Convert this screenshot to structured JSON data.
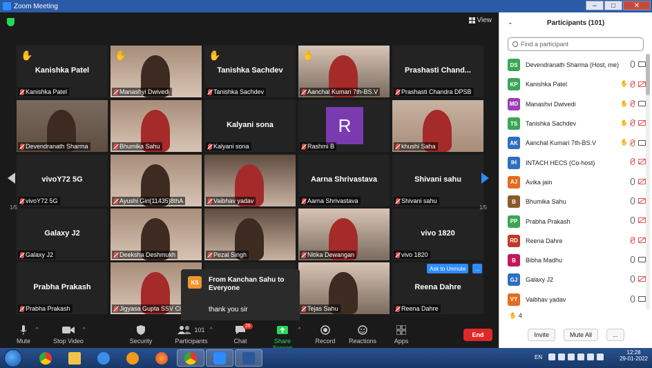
{
  "window": {
    "title": "Zoom Meeting"
  },
  "view_label": "View",
  "tiles": [
    {
      "center": "Kanishka Patel",
      "label": "Kanishka Patel",
      "hand": true,
      "video": false
    },
    {
      "center": "",
      "label": "Manashyi Dwivedi",
      "hand": true,
      "video": true
    },
    {
      "center": "Tanishka Sachdev",
      "label": "Tanishka Sachdev",
      "hand": true,
      "video": false
    },
    {
      "center": "",
      "label": "Aanchal Kumari 7th-BS.V",
      "hand": true,
      "video": true
    },
    {
      "center": "Prashasti  Chand...",
      "label": "Prashasti Chandra DPSB",
      "hand": false,
      "video": false
    },
    {
      "center": "",
      "label": "Devendranath Sharma",
      "hand": false,
      "video": true
    },
    {
      "center": "",
      "label": "Bhumika Sahu",
      "hand": false,
      "video": true
    },
    {
      "center": "Kalyani sona",
      "label": "Kalyani sona",
      "hand": false,
      "video": false
    },
    {
      "center": "",
      "label": "Rashmi B",
      "hand": false,
      "video": false,
      "avatar": "R"
    },
    {
      "center": "",
      "label": "khushi Saha",
      "hand": false,
      "video": true
    },
    {
      "center": "vivoY72 5G",
      "label": "vivoY72 5G",
      "hand": false,
      "video": false
    },
    {
      "center": "",
      "label": "Ayushi Giri(11435)8thA",
      "hand": false,
      "video": true
    },
    {
      "center": "",
      "label": "Vaibhav yadav",
      "hand": false,
      "video": true
    },
    {
      "center": "Aarna Shrivastava",
      "label": "Aarna Shrivastava",
      "hand": false,
      "video": false
    },
    {
      "center": "Shivani sahu",
      "label": "Shivani sahu",
      "hand": false,
      "video": false
    },
    {
      "center": "Galaxy J2",
      "label": "Galaxy J2",
      "hand": false,
      "video": false
    },
    {
      "center": "",
      "label": "Deeksha Deshmukh",
      "hand": false,
      "video": true
    },
    {
      "center": "",
      "label": "Pezal Singh",
      "hand": false,
      "video": true
    },
    {
      "center": "",
      "label": "Nitika Dewangan",
      "hand": false,
      "video": true
    },
    {
      "center": "vivo 1820",
      "label": "vivo 1820",
      "hand": false,
      "video": false
    },
    {
      "center": "Prabha Prakash",
      "label": "Prabha Prakash",
      "hand": false,
      "video": false
    },
    {
      "center": "",
      "label": "Jigyasa Gupta SSV Cl",
      "hand": false,
      "video": true
    },
    {
      "center": "",
      "label": "",
      "hand": false,
      "video": false
    },
    {
      "center": "",
      "label": "Tejas Sahu",
      "hand": false,
      "video": true
    },
    {
      "center": "Reena Dahre",
      "label": "Reena Dahre",
      "hand": false,
      "video": false
    }
  ],
  "pager": {
    "left": "1/5",
    "right": "1/5"
  },
  "toast": {
    "initials": "KS",
    "from": "From Kanchan Sahu to Everyone",
    "message": "thank you sir"
  },
  "ask_unmute": "Ask to Unmute",
  "more": "...",
  "toolbar": {
    "mute": "Mute",
    "video": "Stop Video",
    "security": "Security",
    "participants": "Participants",
    "participant_count": "101",
    "chat": "Chat",
    "chat_badge": "26",
    "share": "Share Screen",
    "record": "Record",
    "reactions": "Reactions",
    "apps": "Apps",
    "end": "End"
  },
  "panel": {
    "title": "Participants (101)",
    "search_placeholder": "Find a participant",
    "participants": [
      {
        "initials": "DS",
        "color": "#3aa655",
        "name": "Devendranath Sharma  (Host, me)",
        "hand": "none",
        "mic": "on",
        "cam": "on"
      },
      {
        "initials": "KP",
        "color": "#3aa655",
        "name": "Kanishka Patel",
        "hand": "raised",
        "mic": "off",
        "cam": "off"
      },
      {
        "initials": "MD",
        "color": "#9b3fb5",
        "name": "Manashvi Dwivedi",
        "hand": "faded",
        "mic": "off",
        "cam": "on"
      },
      {
        "initials": "TS",
        "color": "#3aa655",
        "name": "Tanishka Sachdev",
        "hand": "raised",
        "mic": "off",
        "cam": "off"
      },
      {
        "initials": "AK",
        "color": "#2f6fbf",
        "name": "Aanchal Kumari 7th-BS.V",
        "hand": "raised",
        "mic": "off",
        "cam": "on"
      },
      {
        "initials": "IH",
        "color": "#2f6fbf",
        "name": "INTACH HECS (Co-host)",
        "hand": "none",
        "mic": "off",
        "cam": "off"
      },
      {
        "initials": "AJ",
        "color": "#e56b1f",
        "name": "Avika jain",
        "hand": "none",
        "mic": "on",
        "cam": "off"
      },
      {
        "initials": "B",
        "color": "#8a5a2b",
        "name": "Bhumika Sahu",
        "hand": "none",
        "mic": "on",
        "cam": "off"
      },
      {
        "initials": "PP",
        "color": "#3aa655",
        "name": "Prabha Prakash",
        "hand": "none",
        "mic": "on",
        "cam": "off"
      },
      {
        "initials": "RD",
        "color": "#c0392b",
        "name": "Reena Dahre",
        "hand": "none",
        "mic": "off",
        "cam": "off"
      },
      {
        "initials": "B",
        "color": "#c2185b",
        "name": "Bibha Madhu",
        "hand": "none",
        "mic": "on",
        "cam": "on"
      },
      {
        "initials": "GJ",
        "color": "#2f6fbf",
        "name": "Galaxy J2",
        "hand": "none",
        "mic": "on",
        "cam": "off"
      },
      {
        "initials": "VY",
        "color": "#e56b1f",
        "name": "Vaibhav yadav",
        "hand": "none",
        "mic": "on",
        "cam": "on"
      }
    ],
    "raised_count": "4",
    "invite": "Invite",
    "mute_all": "Mute All",
    "more": "..."
  },
  "taskbar": {
    "lang": "EN",
    "time": "12:28",
    "date": "29-01-2022"
  }
}
